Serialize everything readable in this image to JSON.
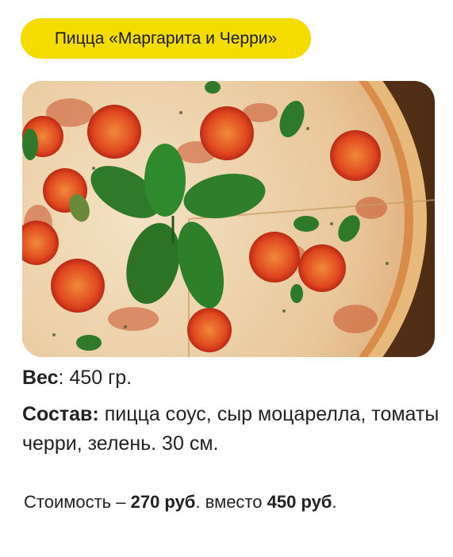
{
  "product": {
    "title": "Пицца «Маргарита и Черри»",
    "image_alt_icon": "pizza-photo"
  },
  "details": {
    "weight_label": "Вес",
    "weight_sep": ":",
    "weight_value": " 450 гр.",
    "composition_label": "Состав:",
    "composition_value": " пицца соус, сыр моцарелла, томаты черри, зелень. 30 см."
  },
  "price": {
    "prefix": "Стоимость – ",
    "new_price": "270 руб",
    "middle": ". вместо ",
    "old_price": "450 руб",
    "suffix": "."
  },
  "colors": {
    "accent": "#f5dc00",
    "text": "#222222"
  }
}
